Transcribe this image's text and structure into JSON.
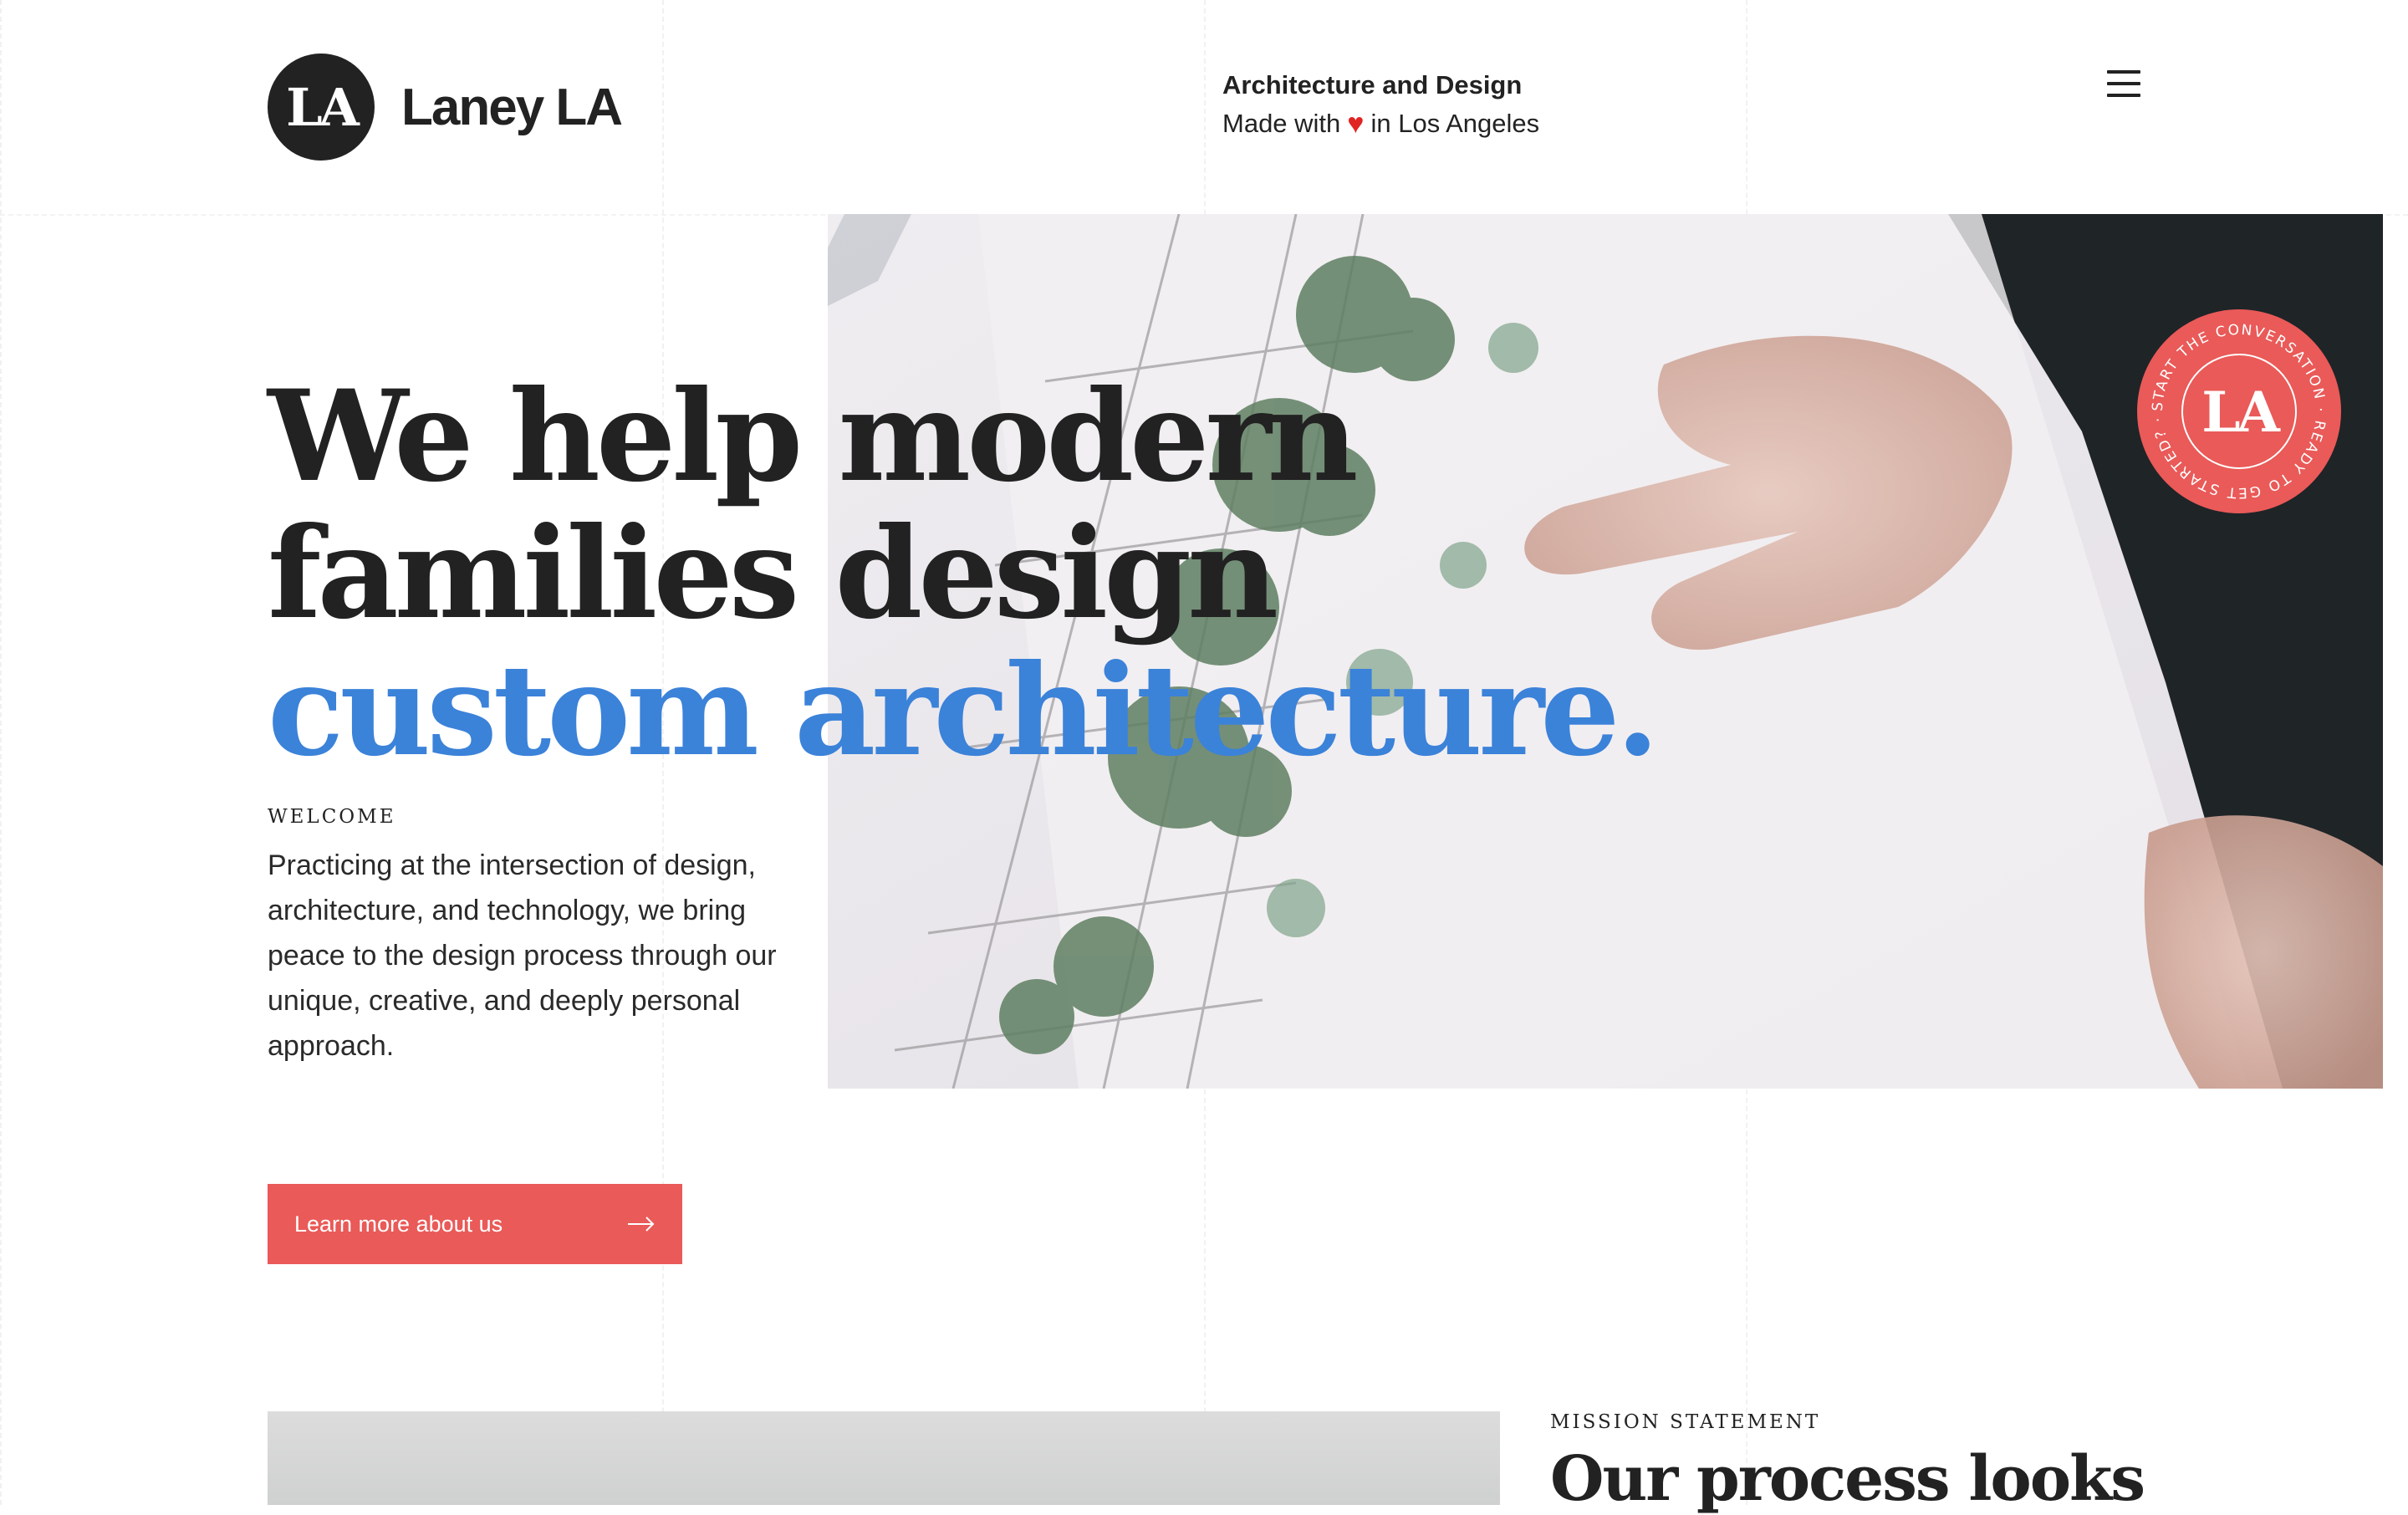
{
  "brand": {
    "mark": "LA",
    "name": "Laney LA"
  },
  "tagline": {
    "title": "Architecture and Design",
    "made_with": "Made with",
    "heart": "♥",
    "location": "in Los Angeles"
  },
  "nav": {
    "menu_icon": "hamburger-menu-icon"
  },
  "hero": {
    "headline_line1": "We help modern",
    "headline_line2": "families design",
    "headline_accent": "custom architecture.",
    "eyebrow": "WELCOME",
    "intro": "Practicing at the intersection of design, architecture, and technology, we bring peace to the design process through our unique, creative, and deeply personal approach.",
    "cta_label": "Learn more about us",
    "cta_icon": "arrow-right-icon"
  },
  "badge": {
    "mark": "LA",
    "ring_text": "START THE CONVERSATION · READY TO GET STARTED? · "
  },
  "mission": {
    "eyebrow": "MISSION STATEMENT",
    "title": "Our process looks"
  },
  "colors": {
    "accent_blue": "#3b82d9",
    "coral": "#e95a58",
    "ink": "#222222",
    "heart": "#e02424"
  }
}
